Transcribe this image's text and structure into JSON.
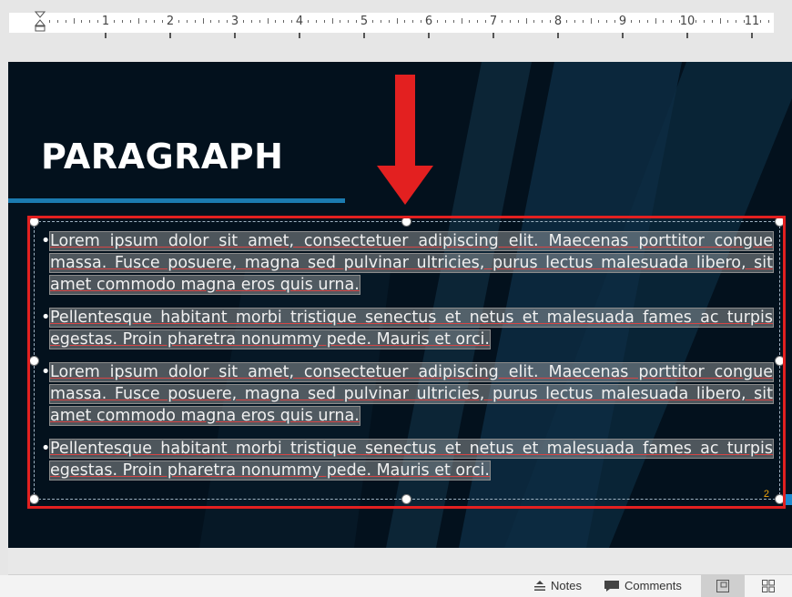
{
  "ruler": {
    "numbers": [
      "1",
      "2",
      "3",
      "4",
      "5",
      "6",
      "7",
      "8",
      "9",
      "10",
      "11"
    ]
  },
  "slide": {
    "title": "PARAGRAPH",
    "paragraphs": [
      "Lorem ipsum dolor sit amet, consectetuer adipiscing elit. Maecenas porttitor congue massa. Fusce posuere, magna sed pulvinar ultricies, purus lectus malesuada libero, sit amet commodo magna eros quis urna.",
      "Pellentesque habitant morbi tristique senectus et netus et malesuada fames ac turpis egestas. Proin pharetra nonummy pede. Mauris et orci.",
      "Lorem ipsum dolor sit amet, consectetuer adipiscing elit. Maecenas porttitor congue massa. Fusce posuere, magna sed pulvinar ultricies, purus lectus malesuada libero, sit amet commodo magna eros quis urna.",
      "Pellentesque habitant morbi tristique senectus et netus et malesuada fames ac turpis egestas. Proin pharetra nonummy pede. Mauris et orci."
    ],
    "bullet": "•",
    "page_number": "2"
  },
  "statusbar": {
    "notes_label": "Notes",
    "comments_label": "Comments"
  },
  "colors": {
    "slide_bg": "#03111d",
    "accent_blue": "#1b7bb0",
    "highlight_red": "#e32020",
    "title_text": "#ffffff"
  },
  "icons": {
    "notes": "notes-icon",
    "comments": "comment-icon",
    "normal_view": "normal-view-icon",
    "slide_sorter": "slide-sorter-icon"
  }
}
